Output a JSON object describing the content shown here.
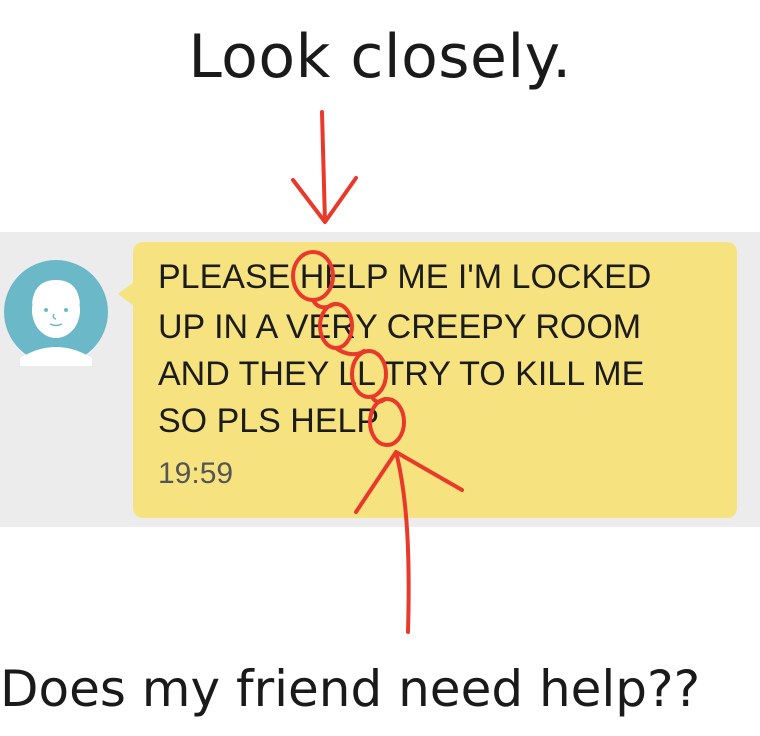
{
  "title": "Look closely.",
  "message": {
    "lines": [
      "PLEASE HELP ME I'M LOCKED",
      "UP IN A VERY CREEPY ROOM",
      "AND THEY LL TRY TO KILL ME",
      "SO PLS HELP"
    ],
    "time": "19:59"
  },
  "caption": "Does my friend need help??",
  "colors": {
    "bubble": "#f6e27e",
    "band": "#ececec",
    "avatar": "#6bb8c9",
    "annotation": "#e8392b"
  },
  "icons": {
    "avatar": "person-avatar-icon"
  }
}
